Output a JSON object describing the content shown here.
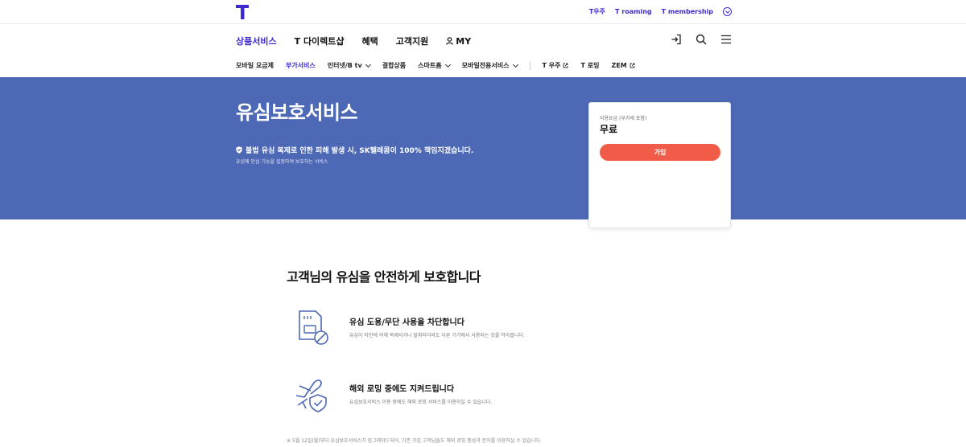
{
  "brand": {
    "accent_color": "#3d2bd0",
    "hero_color": "#4d68b5",
    "button_color": "#f05c47",
    "logo_icon": "t-logo-icon"
  },
  "utility_links": [
    "T우주",
    "T roaming",
    "T membership"
  ],
  "main_nav": {
    "items": [
      "상품서비스",
      "T 다이렉트샵",
      "혜택",
      "고객지원",
      "MY"
    ],
    "icons": [
      "login-icon",
      "search-icon",
      "menu-icon"
    ]
  },
  "sub_nav": {
    "items": [
      "모바일 요금제",
      "부가서비스",
      "인터넷/B tv",
      "결합상품",
      "스마트홈",
      "모바일전용서비스"
    ],
    "external": [
      "T 우주",
      "T 로밍",
      "ZEM"
    ]
  },
  "hero": {
    "title": "유심보호서비스",
    "notice": "불법 유심 복제로 인한 피해 발생 시, SK텔레콤이 100% 책임지겠습니다.",
    "subtitle": "유심에 안심 기능을 설정하여 보호하는 서비스"
  },
  "price_card": {
    "label": "이용요금 (부가세 포함)",
    "value": "무료",
    "join_label": "가입"
  },
  "content": {
    "title": "고객님의 유심을 안전하게 보호합니다",
    "features": [
      {
        "icon": "sim-block-icon",
        "title": "유심 도용/무단 사용을 차단합니다",
        "desc": "유심이 타인에 의해 복제되거나 탈취되더라도 다른 기기에서 사용되는 것을 막아줍니다."
      },
      {
        "icon": "plane-shield-icon",
        "title": "해외 로밍 중에도 지켜드립니다",
        "desc": "유심보호서비스 이용 중에도 해외 로밍 서비스를 이용하실 수 있습니다."
      }
    ],
    "footnote": "※ 5월 12일(월)부터 유심보호서비스가 업그레이드되어, 기존 가입 고객님들도 해외 로밍 종성과 문자를 이용하실 수 있습니다."
  }
}
